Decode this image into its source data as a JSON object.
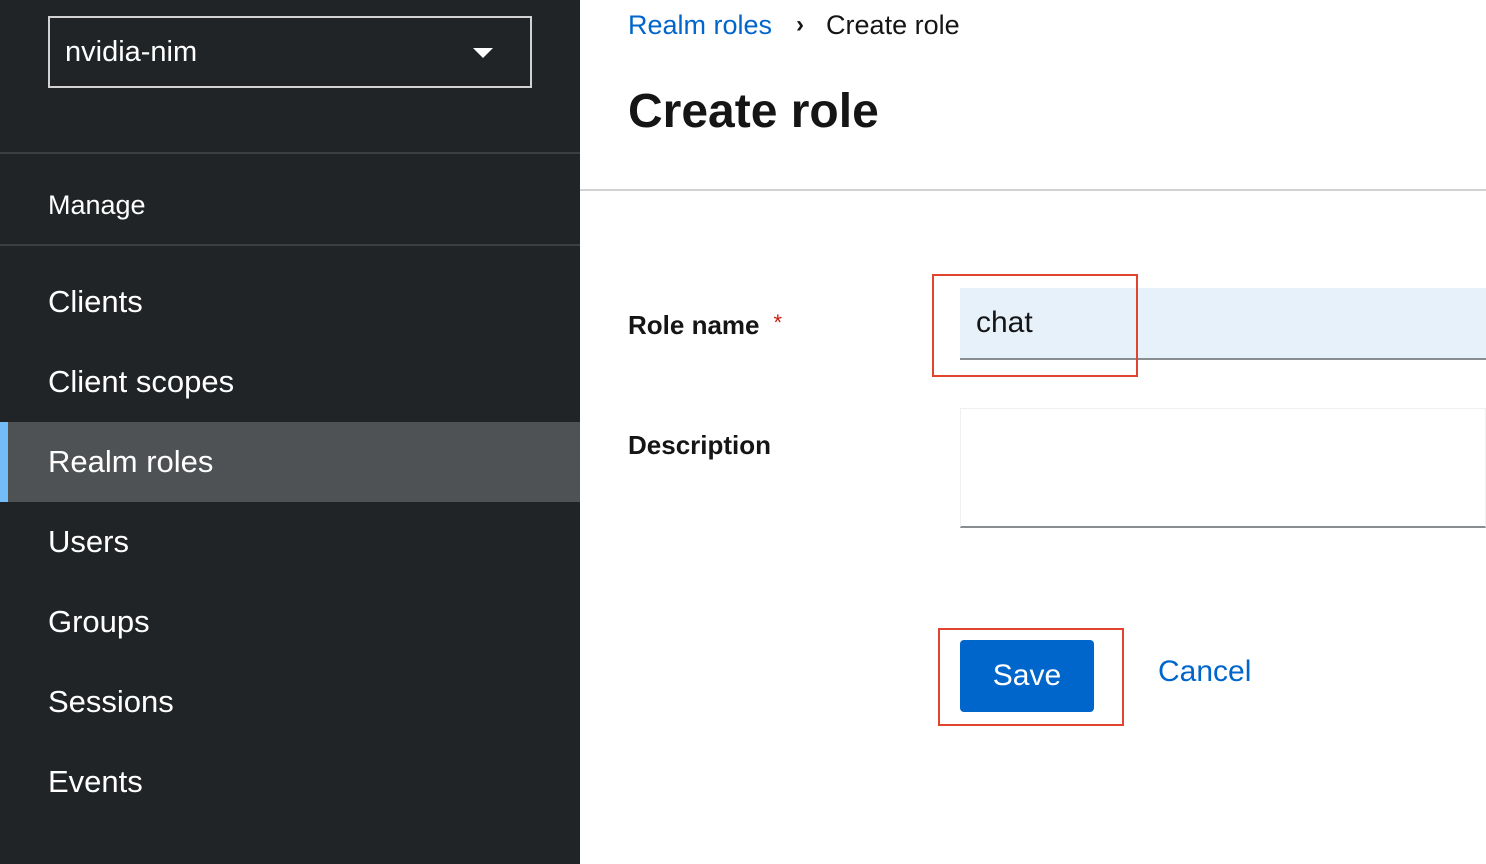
{
  "sidebar": {
    "realm_selector": {
      "value": "nvidia-nim"
    },
    "section_title": "Manage",
    "items": [
      {
        "label": "Clients"
      },
      {
        "label": "Client scopes"
      },
      {
        "label": "Realm roles",
        "active": true
      },
      {
        "label": "Users"
      },
      {
        "label": "Groups"
      },
      {
        "label": "Sessions"
      },
      {
        "label": "Events"
      }
    ]
  },
  "breadcrumb": {
    "parent": "Realm roles",
    "separator": "›",
    "current": "Create role"
  },
  "page": {
    "title": "Create role"
  },
  "form": {
    "role_name": {
      "label": "Role name",
      "required_mark": "*",
      "value": "chat"
    },
    "description": {
      "label": "Description",
      "value": ""
    },
    "save_label": "Save",
    "cancel_label": "Cancel"
  },
  "colors": {
    "sidebar_bg": "#212427",
    "active_item_bg": "#4f5255",
    "active_indicator": "#73bcf7",
    "link": "#0066cc",
    "primary_button": "#0066cc",
    "required": "#c9190b",
    "highlight_box": "#e0442f",
    "input_filled_bg": "#e7f1fa"
  }
}
